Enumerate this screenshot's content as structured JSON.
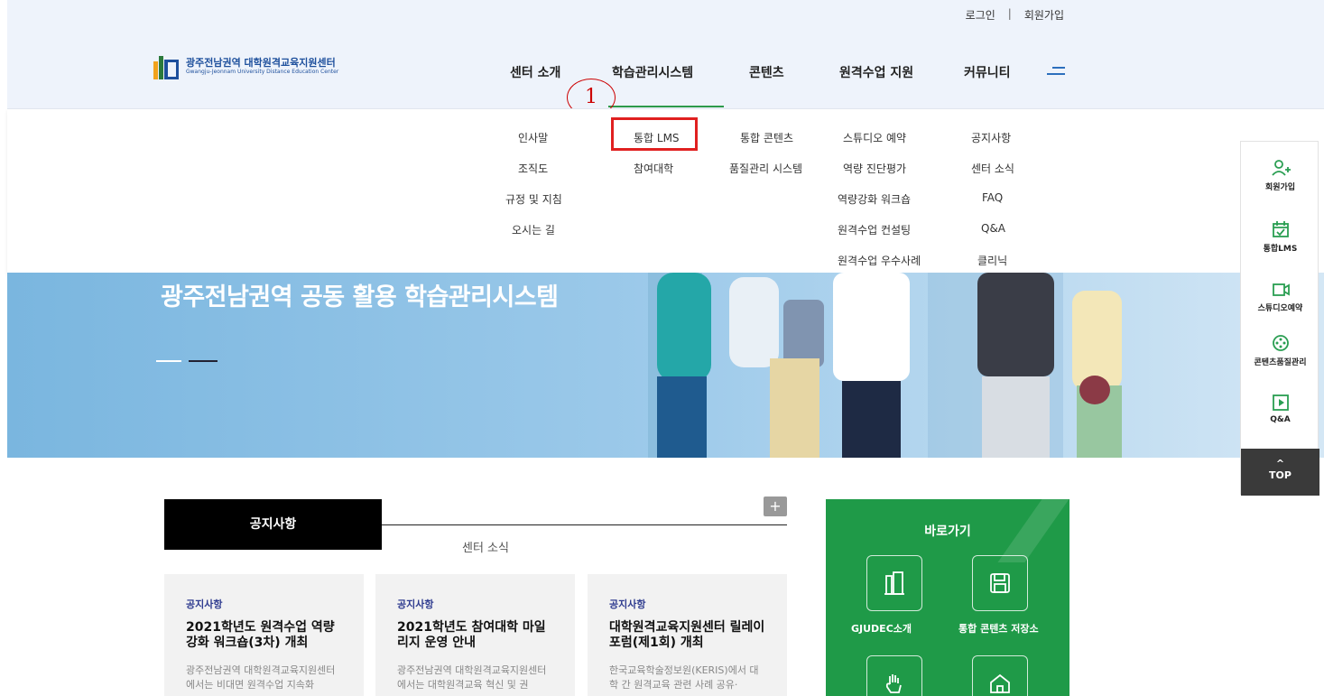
{
  "header": {
    "login": "로그인",
    "separator": "|",
    "signup": "회원가입",
    "logo_ko": "광주전남권역 대학원격교육지원센터",
    "logo_en": "Gwangju-Jeonnam University Distance Education Center"
  },
  "nav": {
    "items": [
      "센터 소개",
      "학습관리시스템",
      "콘텐츠",
      "원격수업 지원",
      "커뮤니티"
    ],
    "annotation": "1"
  },
  "dropdown": {
    "col1": [
      "인사말",
      "조직도",
      "규정 및 지침",
      "오시는 길"
    ],
    "col2": [
      "통합 LMS",
      "참여대학"
    ],
    "col3": [
      "통합 콘텐츠",
      "품질관리 시스템"
    ],
    "col4": [
      "스튜디오 예약",
      "역량 진단평가",
      "역량강화 워크숍",
      "원격수업 컨설팅",
      "원격수업 우수사례"
    ],
    "col5": [
      "공지사항",
      "센터 소식",
      "FAQ",
      "Q&A",
      "클리닉"
    ]
  },
  "hero": {
    "title": "광주전남권역 공동 활용 학습관리시스템"
  },
  "quick_menu": {
    "items": [
      "회원가입",
      "통합LMS",
      "스튜디오예약",
      "콘텐츠품질관리",
      "Q&A"
    ],
    "top_arrow": "^",
    "top_label": "TOP",
    "icons": [
      "user-plus-icon",
      "calendar-check-icon",
      "video-camera-icon",
      "film-reel-icon",
      "play-box-icon"
    ]
  },
  "notices": {
    "tab_active": "공지사항",
    "tab_inactive": "센터 소식",
    "more": "+",
    "cards": [
      {
        "category": "공지사항",
        "title": "2021학년도 원격수업 역량강화 워크숍(3차) 개최",
        "desc": "광주전남권역 대학원격교육지원센터에서는 비대면 원격수업 지속화"
      },
      {
        "category": "공지사항",
        "title": "2021학년도 참여대학 마일리지 운영 안내",
        "desc": "광주전남권역 대학원격교육지원센터에서는 대학원격교육 혁신 및 권"
      },
      {
        "category": "공지사항",
        "title": "대학원격교육지원센터 릴레이 포럼(제1회) 개최",
        "desc": "한국교육학술정보원(KERIS)에서 대학 간 원격교육 관련 사례 공유·"
      }
    ]
  },
  "quicklinks": {
    "title": "바로가기",
    "items": [
      "GJUDEC소개",
      "통합 콘텐츠 저장소"
    ],
    "colors": {
      "bg": "#1f9a48"
    }
  },
  "colors": {
    "accent_green": "#2d9a4a",
    "highlight_red": "#e02020",
    "brand_blue": "#1d4f9c"
  }
}
